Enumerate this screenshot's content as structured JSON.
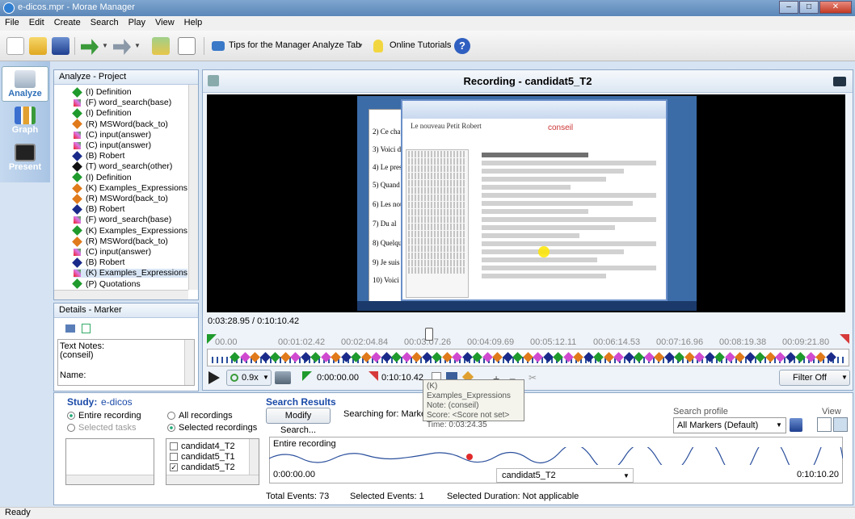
{
  "window": {
    "title": "e-dicos.mpr - Morae Manager"
  },
  "menu": [
    "File",
    "Edit",
    "Create",
    "Search",
    "Play",
    "View",
    "Help"
  ],
  "toolbar": {
    "tips_label": "Tips for the Manager Analyze Tab",
    "tutorials_label": "Online Tutorials"
  },
  "nav": [
    {
      "label": "Analyze",
      "icon": "analyze-icon",
      "active": true
    },
    {
      "label": "Graph",
      "icon": "graph-icon",
      "active": false
    },
    {
      "label": "Present",
      "icon": "present-icon",
      "active": false
    }
  ],
  "project": {
    "title": "Analyze - Project",
    "items": [
      {
        "label": "(I) Definition",
        "color": "#1f9a2c",
        "kind": "diamond"
      },
      {
        "label": "(F) word_search(base)",
        "color": "#d63a3a",
        "kind": "multi"
      },
      {
        "label": "(I) Definition",
        "color": "#1f9a2c",
        "kind": "diamond"
      },
      {
        "label": "(R) MSWord(back_to)",
        "color": "#e07a1a",
        "kind": "diamond"
      },
      {
        "label": "(C) input(answer)",
        "color": "#d04ad0",
        "kind": "multi"
      },
      {
        "label": "(C) input(answer)",
        "color": "#d04ad0",
        "kind": "multi"
      },
      {
        "label": "(B) Robert",
        "color": "#1a2a8a",
        "kind": "diamond"
      },
      {
        "label": "(T) word_search(other)",
        "color": "#111111",
        "kind": "diamond"
      },
      {
        "label": "(I) Definition",
        "color": "#1f9a2c",
        "kind": "diamond"
      },
      {
        "label": "(K) Examples_Expressions",
        "color": "#e07a1a",
        "kind": "diamond"
      },
      {
        "label": "(R) MSWord(back_to)",
        "color": "#e07a1a",
        "kind": "diamond"
      },
      {
        "label": "(B) Robert",
        "color": "#1a2a8a",
        "kind": "diamond"
      },
      {
        "label": "(F) word_search(base)",
        "color": "#d63a3a",
        "kind": "multi"
      },
      {
        "label": "(K) Examples_Expressions",
        "color": "#1f9a2c",
        "kind": "diamond"
      },
      {
        "label": "(R) MSWord(back_to)",
        "color": "#e07a1a",
        "kind": "diamond"
      },
      {
        "label": "(C) input(answer)",
        "color": "#d04ad0",
        "kind": "multi"
      },
      {
        "label": "(B) Robert",
        "color": "#1a2a8a",
        "kind": "diamond"
      },
      {
        "label": "(K) Examples_Expressions",
        "color": "#d04ad0",
        "kind": "multi"
      },
      {
        "label": "(P) Quotations",
        "color": "#1f9a2c",
        "kind": "diamond"
      }
    ]
  },
  "recording": {
    "title": "Recording - candidat5_T2",
    "position": "0:03:28.95 / 0:10:10.42"
  },
  "timeline": {
    "ticks": [
      "00.00",
      "00:01:02.42",
      "00:02:04.84",
      "00:03:07.26",
      "00:04:09.69",
      "00:05:12.11",
      "00:06:14.53",
      "00:07:16.96",
      "00:08:19.38",
      "00:09:21.80"
    ],
    "speed": "0.9x",
    "in_time": "0:00:00.00",
    "out_time": "0:10:10.42",
    "filter": "Filter Off"
  },
  "details": {
    "title": "Details - Marker",
    "text_notes_label": "Text Notes:",
    "text_notes_value": "(conseil)",
    "name_label": "Name:"
  },
  "tooltip": {
    "line1": "(K) Examples_Expressions",
    "line2": "Note: (conseil)",
    "line3": "Score: <Score not set>",
    "line4": "Time: 0:03:24.35"
  },
  "study": {
    "label": "Study:",
    "name": "e-dicos",
    "entire_recording": "Entire recording",
    "selected_tasks": "Selected tasks",
    "all_recordings": "All recordings",
    "selected_recordings": "Selected recordings",
    "recordings": [
      {
        "name": "candidat4_T2",
        "checked": false
      },
      {
        "name": "candidat5_T1",
        "checked": false
      },
      {
        "name": "candidat5_T2",
        "checked": true
      }
    ]
  },
  "search": {
    "title": "Search Results",
    "modify_button": "Modify Search...",
    "searching_for": "Searching for: Markers [a",
    "entire_recording_label": "Entire recording",
    "start_time": "0:00:00.00",
    "end_time": "0:10:10.20",
    "recording_select": "candidat5_T2",
    "total_events": "Total Events: 73",
    "selected_events": "Selected Events: 1",
    "selected_duration": "Selected Duration: Not applicable"
  },
  "search_profile": {
    "label": "Search profile",
    "value": "All Markers (Default)",
    "view_label": "View"
  },
  "status": "Ready"
}
